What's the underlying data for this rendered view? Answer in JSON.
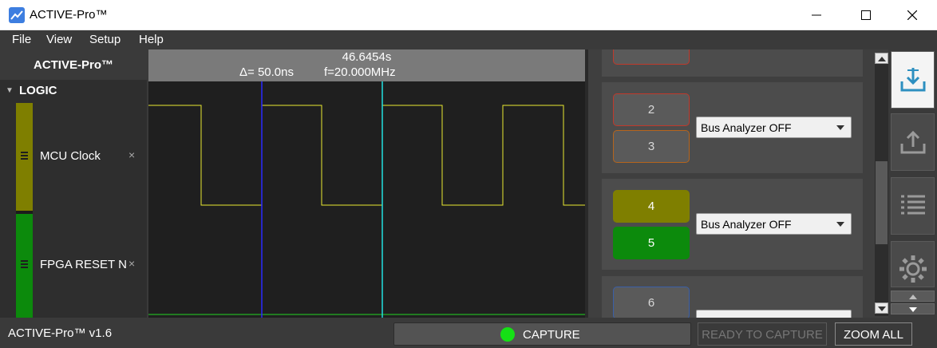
{
  "window": {
    "title": "ACTIVE-Pro™"
  },
  "menu": [
    "File",
    "View",
    "Setup",
    "Help"
  ],
  "left_panel": {
    "header": "ACTIVE-Pro™",
    "section": "LOGIC",
    "channels": [
      {
        "name": "MCU Clock",
        "color": "#7f7f00"
      },
      {
        "name": "FPGA RESET N",
        "color": "#0c8a0c"
      }
    ],
    "remove_glyph": "×"
  },
  "waveform": {
    "time_readout": "46.6454s",
    "delta_readout": "Δ= 50.0ns",
    "freq_readout": "f=20.000MHz",
    "signal_colors": {
      "clock": "#e8e830",
      "reset": "#23d623",
      "cursor_a": "#2a2aff",
      "cursor_b": "#22e0e0"
    }
  },
  "right_panel": {
    "groups": [
      {
        "channels": [
          {
            "label": "",
            "style": "outline",
            "border": "#c0392b"
          }
        ],
        "bus": null
      },
      {
        "channels": [
          {
            "label": "2",
            "style": "outline",
            "border": "#c0392b"
          },
          {
            "label": "3",
            "style": "outline",
            "border": "#b5651d"
          }
        ],
        "bus": "Bus Analyzer OFF"
      },
      {
        "channels": [
          {
            "label": "4",
            "style": "filled",
            "fill": "#7f7f00"
          },
          {
            "label": "5",
            "style": "filled",
            "fill": "#0c8a0c"
          }
        ],
        "bus": "Bus Analyzer OFF"
      },
      {
        "channels": [
          {
            "label": "6",
            "style": "outline",
            "border": "#3a5fa8"
          }
        ],
        "bus": ""
      }
    ]
  },
  "toolbar": {
    "tools": [
      "download-icon",
      "upload-icon",
      "list-icon",
      "settings-gear-icon"
    ]
  },
  "status": {
    "version": "ACTIVE-Pro™ v1.6",
    "capture_label": "CAPTURE",
    "ready_label": "READY TO CAPTURE",
    "zoom_label": "ZOOM ALL",
    "capture_dot_color": "#15e015"
  }
}
